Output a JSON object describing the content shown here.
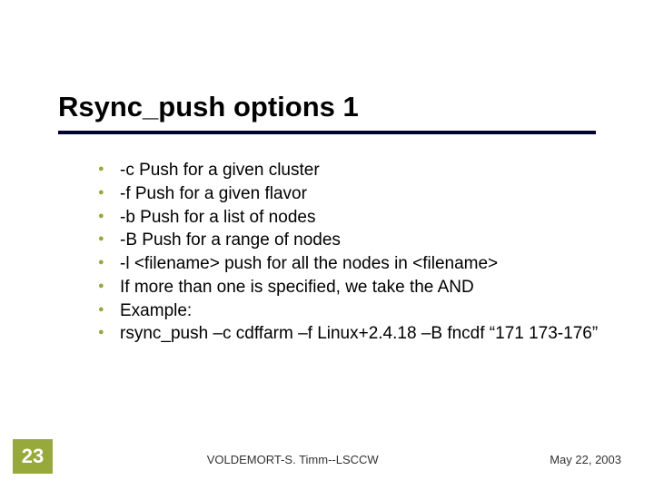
{
  "title": "Rsync_push options 1",
  "bullets": [
    "-c  Push for a given cluster",
    "-f  Push for a given flavor",
    "-b Push for a list of nodes",
    "-B Push for a range of nodes",
    "-l <filename>  push for all the nodes in <filename>",
    "If more than one is specified, we take the AND",
    "Example:",
    "rsync_push –c cdffarm –f Linux+2.4.18 –B fncdf “171 173-176”"
  ],
  "footer": {
    "page": "23",
    "center": "VOLDEMORT-S. Timm--LSCCW",
    "right": "May 22, 2003"
  }
}
